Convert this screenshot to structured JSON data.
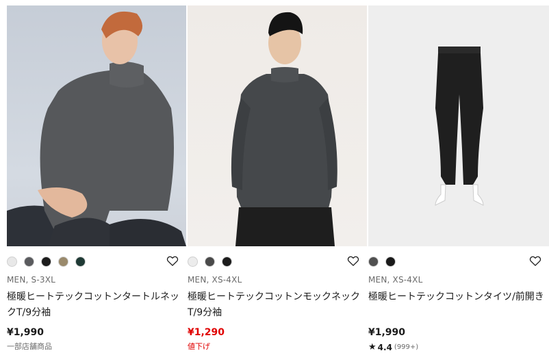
{
  "products": [
    {
      "swatches": [
        "#e8e8e8",
        "#5a5b5e",
        "#1c1c1c",
        "#9a8a6c",
        "#1f3a35"
      ],
      "gender_size": "MEN, S-3XL",
      "name": "極暖ヒートテックコットンタートルネックT/9分袖",
      "price": "¥1,990",
      "note": "一部店舗商品"
    },
    {
      "swatches": [
        "#ececec",
        "#4a4a4a",
        "#1c1c1c"
      ],
      "gender_size": "MEN, XS-4XL",
      "name": "極暖ヒートテックコットンモックネックT/9分袖",
      "price": "¥1,290",
      "note": "値下げ",
      "price_color": "#e00000"
    },
    {
      "swatches": [
        "#505050",
        "#1a1a1a"
      ],
      "gender_size": "MEN, XS-4XL",
      "name": "極暖ヒートテックコットンタイツ/前開き",
      "price": "¥1,990",
      "rating": {
        "star": "★",
        "score": "4.4",
        "count": "(999+)"
      }
    }
  ]
}
